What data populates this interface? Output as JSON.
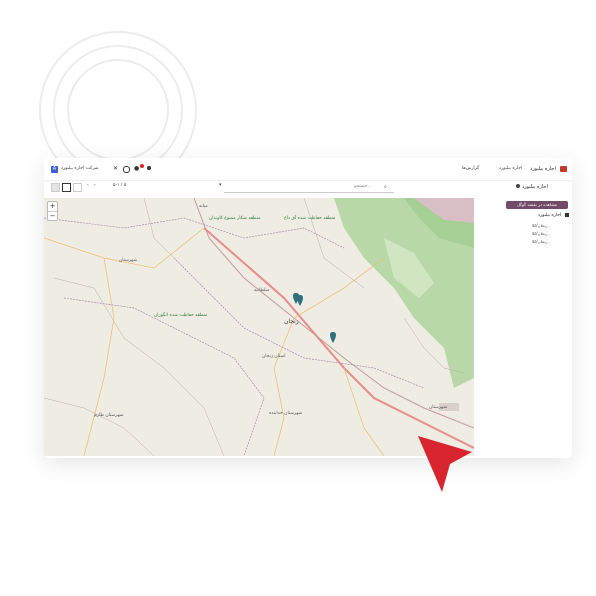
{
  "app": {
    "company_label": "شرکت اجاره بیلبورد",
    "company_avatar": "A",
    "module_title": "اجاره بیلبورد",
    "menu": [
      "اجاره بیلبورد",
      "گزارش‌ها"
    ]
  },
  "control": {
    "breadcrumb": "اجاره بیلبورد",
    "search_placeholder": "جستجو...",
    "pager": "۵-۱ / ۵"
  },
  "sidebar": {
    "action_button": "مشاهده در نقشه گوگل",
    "group_title": "اجاره بیلبورد",
    "items": [
      "زنجان/کلا",
      "زنجان/کلا",
      "زنجان/کلا"
    ]
  },
  "map": {
    "zoom_in": "+",
    "zoom_out": "−",
    "labels": {
      "abhar": "زنجان",
      "province": "استان زنجان",
      "area1": "منطقه حفاظت شده انگوران",
      "area2": "منطقه شکار ممنوع کاوندان",
      "area3": "منطقه حفاظت شده آق داغ",
      "city_a": "شهرستان",
      "city_b": "شهرستان خدابنده",
      "city_c": "شهرستان طارم",
      "tehran_side": "شهرستان",
      "zanjan_small": "سلطانیه",
      "top_left": "میانه"
    }
  },
  "colors": {
    "brand": "#714B67",
    "accent_red": "#D9252F",
    "map_bg": "#efece4",
    "map_green": "#b8d8a8",
    "marker": "#2e6f7e"
  }
}
